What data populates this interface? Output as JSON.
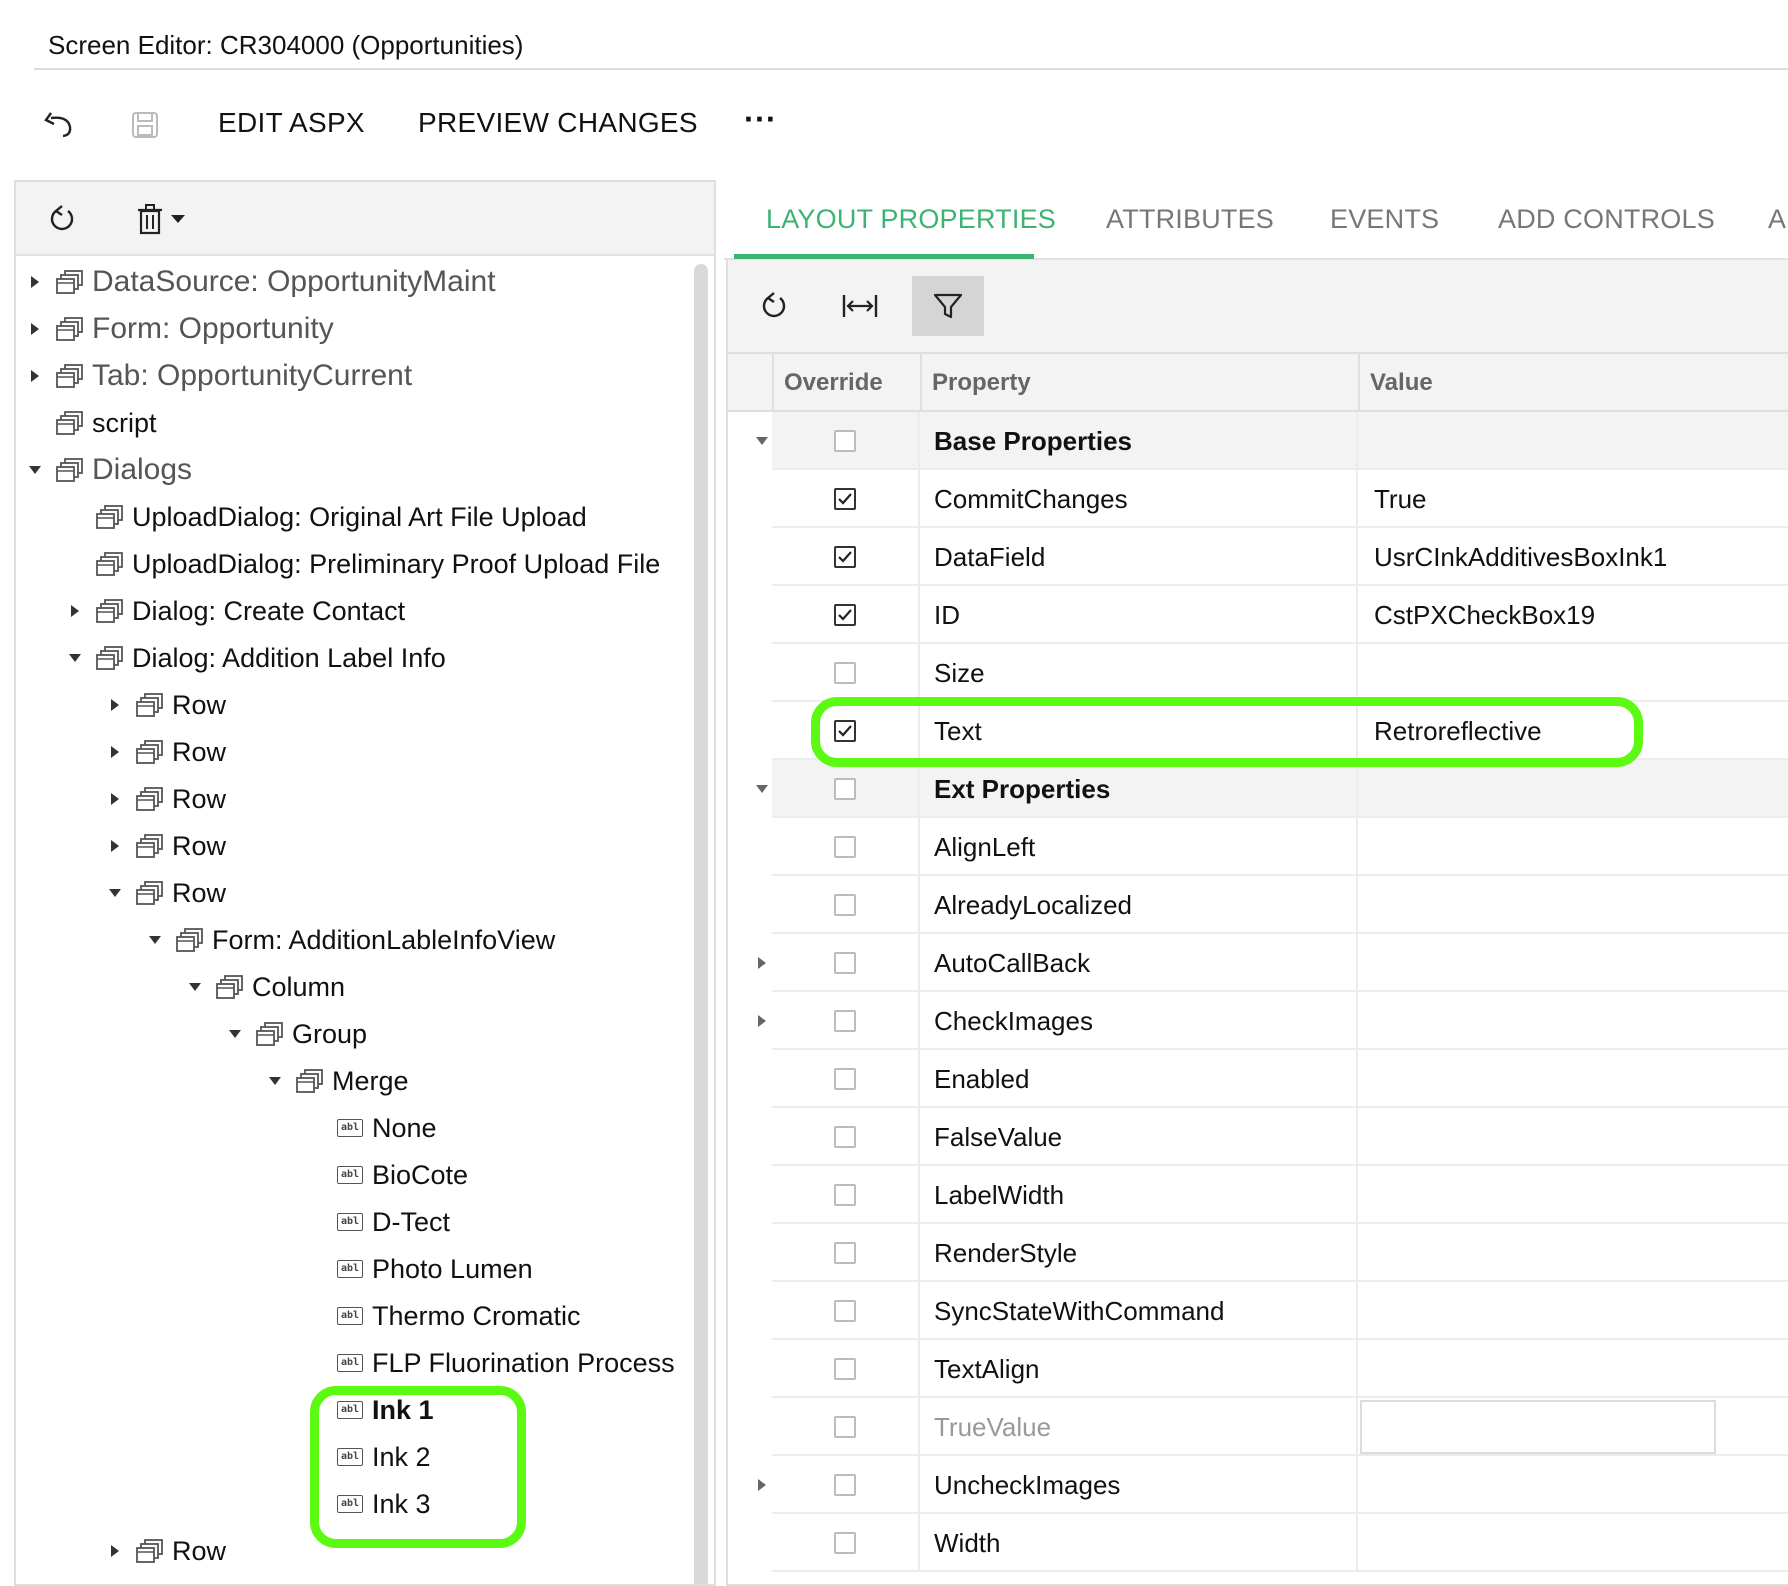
{
  "window": {
    "title": "Screen Editor: CR304000 (Opportunities)"
  },
  "toolbar": {
    "undo_icon": "undo-icon",
    "save_icon": "save-icon",
    "edit_aspx_label": "EDIT ASPX",
    "preview_changes_label": "PREVIEW CHANGES",
    "more_label": "···"
  },
  "left_toolbar": {
    "refresh_icon": "refresh-icon",
    "delete_icon": "trash-icon",
    "dropdown_icon": "caret-down-icon"
  },
  "tree": {
    "nodes": [
      {
        "label": "DataSource: OpportunityMaint",
        "level": 0,
        "state": "collapsed",
        "icon": "container",
        "top": true
      },
      {
        "label": "Form: Opportunity",
        "level": 0,
        "state": "collapsed",
        "icon": "container",
        "top": true
      },
      {
        "label": "Tab: OpportunityCurrent",
        "level": 0,
        "state": "collapsed",
        "icon": "container",
        "top": true
      },
      {
        "label": "script",
        "level": 0,
        "state": "leaf",
        "icon": "container"
      },
      {
        "label": "Dialogs",
        "level": 0,
        "state": "expanded",
        "icon": "container",
        "top": true
      },
      {
        "label": "UploadDialog: Original Art File Upload",
        "level": 1,
        "state": "leaf",
        "icon": "container"
      },
      {
        "label": "UploadDialog: Preliminary Proof Upload File",
        "level": 1,
        "state": "leaf",
        "icon": "container"
      },
      {
        "label": "Dialog: Create Contact",
        "level": 1,
        "state": "collapsed",
        "icon": "container"
      },
      {
        "label": "Dialog: Addition Label Info",
        "level": 1,
        "state": "expanded",
        "icon": "container"
      },
      {
        "label": "Row",
        "level": 2,
        "state": "collapsed",
        "icon": "container"
      },
      {
        "label": "Row",
        "level": 2,
        "state": "collapsed",
        "icon": "container"
      },
      {
        "label": "Row",
        "level": 2,
        "state": "collapsed",
        "icon": "container"
      },
      {
        "label": "Row",
        "level": 2,
        "state": "collapsed",
        "icon": "container"
      },
      {
        "label": "Row",
        "level": 2,
        "state": "expanded",
        "icon": "container"
      },
      {
        "label": "Form: AdditionLableInfoView",
        "level": 3,
        "state": "expanded",
        "icon": "container"
      },
      {
        "label": "Column",
        "level": 4,
        "state": "expanded",
        "icon": "container"
      },
      {
        "label": "Group",
        "level": 5,
        "state": "expanded",
        "icon": "container"
      },
      {
        "label": "Merge",
        "level": 6,
        "state": "expanded",
        "icon": "container"
      },
      {
        "label": "None",
        "level": 7,
        "state": "leaf",
        "icon": "field"
      },
      {
        "label": "BioCote",
        "level": 7,
        "state": "leaf",
        "icon": "field"
      },
      {
        "label": "D-Tect",
        "level": 7,
        "state": "leaf",
        "icon": "field"
      },
      {
        "label": "Photo Lumen",
        "level": 7,
        "state": "leaf",
        "icon": "field"
      },
      {
        "label": "Thermo Cromatic",
        "level": 7,
        "state": "leaf",
        "icon": "field"
      },
      {
        "label": "FLP Fluorination Process",
        "level": 7,
        "state": "leaf",
        "icon": "field"
      },
      {
        "label": "Ink 1",
        "level": 7,
        "state": "leaf",
        "icon": "field",
        "bold": true
      },
      {
        "label": "Ink 2",
        "level": 7,
        "state": "leaf",
        "icon": "field"
      },
      {
        "label": "Ink 3",
        "level": 7,
        "state": "leaf",
        "icon": "field"
      },
      {
        "label": "Row",
        "level": 2,
        "state": "collapsed",
        "icon": "container"
      }
    ]
  },
  "tabs": {
    "layout_properties": "LAYOUT PROPERTIES",
    "attributes": "ATTRIBUTES",
    "events": "EVENTS",
    "add_controls": "ADD CONTROLS",
    "overflow": "A"
  },
  "prop_toolbar": {
    "refresh_icon": "refresh-icon",
    "fit_width_icon": "fit-width-icon",
    "filter_icon": "filter-icon"
  },
  "grid": {
    "headers": {
      "override": "Override",
      "property": "Property",
      "value": "Value"
    },
    "rows": [
      {
        "type": "group",
        "property": "Base Properties",
        "value": "",
        "checked": false,
        "arrow": "down"
      },
      {
        "type": "prop",
        "property": "CommitChanges",
        "value": "True",
        "checked": true
      },
      {
        "type": "prop",
        "property": "DataField",
        "value": "UsrCInkAdditivesBoxInk1",
        "checked": true
      },
      {
        "type": "prop",
        "property": "ID",
        "value": "CstPXCheckBox19",
        "checked": true
      },
      {
        "type": "prop",
        "property": "Size",
        "value": "",
        "checked": false
      },
      {
        "type": "prop",
        "property": "Text",
        "value": "Retroreflective",
        "checked": true
      },
      {
        "type": "group",
        "property": "Ext Properties",
        "value": "",
        "checked": false,
        "arrow": "down"
      },
      {
        "type": "prop",
        "property": "AlignLeft",
        "value": "",
        "checked": false
      },
      {
        "type": "prop",
        "property": "AlreadyLocalized",
        "value": "",
        "checked": false
      },
      {
        "type": "prop",
        "property": "AutoCallBack",
        "value": "",
        "checked": false,
        "arrow": "right"
      },
      {
        "type": "prop",
        "property": "CheckImages",
        "value": "",
        "checked": false,
        "arrow": "right"
      },
      {
        "type": "prop",
        "property": "Enabled",
        "value": "",
        "checked": false
      },
      {
        "type": "prop",
        "property": "FalseValue",
        "value": "",
        "checked": false
      },
      {
        "type": "prop",
        "property": "LabelWidth",
        "value": "",
        "checked": false
      },
      {
        "type": "prop",
        "property": "RenderStyle",
        "value": "",
        "checked": false
      },
      {
        "type": "prop",
        "property": "SyncStateWithCommand",
        "value": "",
        "checked": false
      },
      {
        "type": "prop",
        "property": "TextAlign",
        "value": "",
        "checked": false
      },
      {
        "type": "prop",
        "property": "TrueValue",
        "value": "",
        "checked": false,
        "dim": true,
        "input": true
      },
      {
        "type": "prop",
        "property": "UncheckImages",
        "value": "",
        "checked": false,
        "arrow": "right"
      },
      {
        "type": "prop",
        "property": "Width",
        "value": "",
        "checked": false
      }
    ]
  },
  "colors": {
    "accent": "#3db372",
    "highlight": "#5cfa12"
  }
}
